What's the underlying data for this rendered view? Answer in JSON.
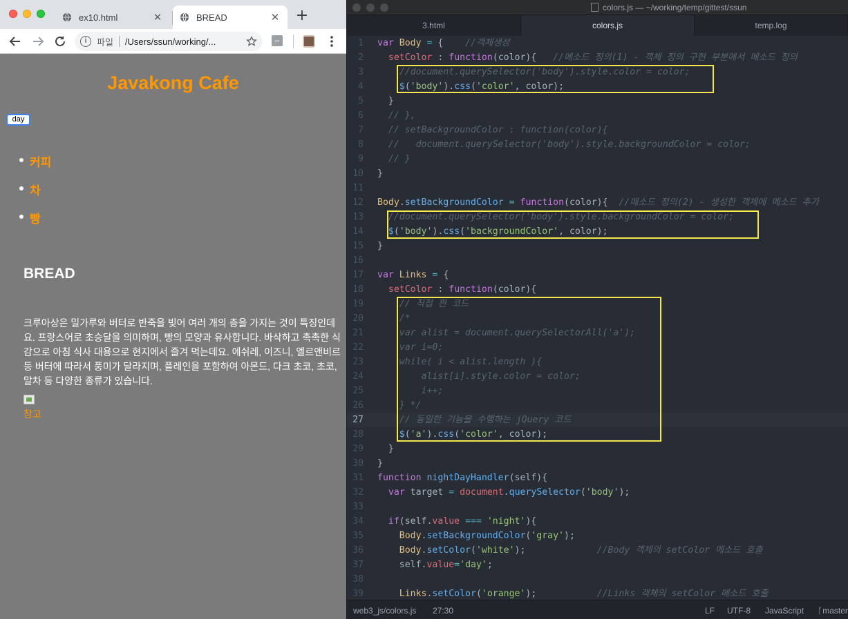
{
  "browser": {
    "tabs": [
      {
        "label": "ex10.html",
        "active": false
      },
      {
        "label": "BREAD",
        "active": true
      }
    ],
    "address": {
      "scheme_label": "파일",
      "url": "/Users/ssun/working/..."
    }
  },
  "page": {
    "cafe_title": "Javakong Cafe",
    "toggle_button": "day",
    "menu_items": [
      "커피",
      "차",
      "빵"
    ],
    "heading": "BREAD",
    "description": "크루아상은 밀가루와 버터로 반죽을 빚어 여러 개의 층을 가지는 것이 특징인데요. 프랑스어로 초승달을 의미하며, 빵의 모양과 유사합니다. 바삭하고 촉촉한 식감으로 아침 식사 대용으로 현지에서 즐겨 먹는데요. 에쉬레, 이즈니, 엘르앤비르 등 버터에 따라서 풍미가 달라지며, 플레인을 포함하여 아몬드, 다크 초코, 초코, 말차 등 다양한 종류가 있습니다.",
    "link": "참고",
    "colors": {
      "link": "#ff9700",
      "background": "#7b7b7b",
      "text": "#ffffff"
    }
  },
  "editor": {
    "window_title": "colors.js — ~/working/temp/gittest/ssun",
    "tabs": [
      {
        "label": "3.html",
        "active": false
      },
      {
        "label": "colors.js",
        "active": true
      },
      {
        "label": "temp.log",
        "active": false
      }
    ],
    "current_line": 27,
    "lines": [
      [
        [
          "kw",
          "var "
        ],
        [
          "obj",
          "Body"
        ],
        [
          "pl",
          " "
        ],
        [
          "op",
          "="
        ],
        [
          "pl",
          " {    "
        ],
        [
          "cm",
          "//객체생성"
        ]
      ],
      [
        [
          "pl",
          "  "
        ],
        [
          "prop",
          "setColor"
        ],
        [
          "pl",
          " : "
        ],
        [
          "kw",
          "function"
        ],
        [
          "pl",
          "(color){   "
        ],
        [
          "cm",
          "//메소드 정의(1) - 객체 정의 구현 부분에서 메소드 정의"
        ]
      ],
      [
        [
          "cm",
          "    //document.querySelector('body').style.color = color;"
        ]
      ],
      [
        [
          "pl",
          "    "
        ],
        [
          "fn",
          "$"
        ],
        [
          "pl",
          "("
        ],
        [
          "str",
          "'body'"
        ],
        [
          "pl",
          ")."
        ],
        [
          "fn",
          "css"
        ],
        [
          "pl",
          "("
        ],
        [
          "str",
          "'color'"
        ],
        [
          "pl",
          ", color);"
        ]
      ],
      [
        [
          "pl",
          "  }"
        ]
      ],
      [
        [
          "cm",
          "  // },"
        ]
      ],
      [
        [
          "cm",
          "  // setBackgroundColor : function(color){"
        ]
      ],
      [
        [
          "cm",
          "  //   document.querySelector('body').style.backgroundColor = color;"
        ]
      ],
      [
        [
          "cm",
          "  // }"
        ]
      ],
      [
        [
          "pl",
          "}"
        ]
      ],
      [],
      [
        [
          "obj",
          "Body"
        ],
        [
          "pl",
          "."
        ],
        [
          "fn",
          "setBackgroundColor"
        ],
        [
          "pl",
          " "
        ],
        [
          "op",
          "="
        ],
        [
          "pl",
          " "
        ],
        [
          "kw",
          "function"
        ],
        [
          "pl",
          "(color){  "
        ],
        [
          "cm",
          "//메소드 정의(2) - 생성한 객체에 메소드 추가"
        ]
      ],
      [
        [
          "cm",
          "  //document.querySelector('body').style.backgroundColor = color;"
        ]
      ],
      [
        [
          "pl",
          "  "
        ],
        [
          "fn",
          "$"
        ],
        [
          "pl",
          "("
        ],
        [
          "str",
          "'body'"
        ],
        [
          "pl",
          ")."
        ],
        [
          "fn",
          "css"
        ],
        [
          "pl",
          "("
        ],
        [
          "str",
          "'backgroundColor'"
        ],
        [
          "pl",
          ", color);"
        ]
      ],
      [
        [
          "pl",
          "}"
        ]
      ],
      [],
      [
        [
          "kw",
          "var "
        ],
        [
          "obj",
          "Links"
        ],
        [
          "pl",
          " "
        ],
        [
          "op",
          "="
        ],
        [
          "pl",
          " {"
        ]
      ],
      [
        [
          "pl",
          "  "
        ],
        [
          "prop",
          "setColor"
        ],
        [
          "pl",
          " : "
        ],
        [
          "kw",
          "function"
        ],
        [
          "pl",
          "(color){"
        ]
      ],
      [
        [
          "cm",
          "    // 직접 짠 코드"
        ]
      ],
      [
        [
          "cm",
          "    /*"
        ]
      ],
      [
        [
          "cm",
          "    var alist = document.querySelectorAll('a');"
        ]
      ],
      [
        [
          "cm",
          "    var i=0;"
        ]
      ],
      [
        [
          "cm",
          "    while( i < alist.length ){"
        ]
      ],
      [
        [
          "cm",
          "        alist[i].style.color = color;"
        ]
      ],
      [
        [
          "cm",
          "        i++;"
        ]
      ],
      [
        [
          "cm",
          "    } */"
        ]
      ],
      [
        [
          "cm",
          "    // 동일한 기능을 수행하는 jQuery 코드"
        ]
      ],
      [
        [
          "pl",
          "    "
        ],
        [
          "fn",
          "$"
        ],
        [
          "pl",
          "("
        ],
        [
          "str",
          "'a'"
        ],
        [
          "pl",
          ")."
        ],
        [
          "fn",
          "css"
        ],
        [
          "pl",
          "("
        ],
        [
          "str",
          "'color'"
        ],
        [
          "pl",
          ", color);"
        ]
      ],
      [
        [
          "pl",
          "  }"
        ]
      ],
      [
        [
          "pl",
          "}"
        ]
      ],
      [
        [
          "kw",
          "function "
        ],
        [
          "fn",
          "nightDayHandler"
        ],
        [
          "pl",
          "(self){"
        ]
      ],
      [
        [
          "pl",
          "  "
        ],
        [
          "kw",
          "var "
        ],
        [
          "pl",
          "target "
        ],
        [
          "op",
          "="
        ],
        [
          "pl",
          " "
        ],
        [
          "prop",
          "document"
        ],
        [
          "pl",
          "."
        ],
        [
          "fn",
          "querySelector"
        ],
        [
          "pl",
          "("
        ],
        [
          "str",
          "'body'"
        ],
        [
          "pl",
          ");"
        ]
      ],
      [],
      [
        [
          "pl",
          "  "
        ],
        [
          "kw",
          "if"
        ],
        [
          "pl",
          "(self."
        ],
        [
          "prop",
          "value"
        ],
        [
          "pl",
          " "
        ],
        [
          "op",
          "==="
        ],
        [
          "pl",
          " "
        ],
        [
          "str",
          "'night'"
        ],
        [
          "pl",
          "){"
        ]
      ],
      [
        [
          "pl",
          "    "
        ],
        [
          "obj",
          "Body"
        ],
        [
          "pl",
          "."
        ],
        [
          "fn",
          "setBackgroundColor"
        ],
        [
          "pl",
          "("
        ],
        [
          "str",
          "'gray'"
        ],
        [
          "pl",
          ");"
        ]
      ],
      [
        [
          "pl",
          "    "
        ],
        [
          "obj",
          "Body"
        ],
        [
          "pl",
          "."
        ],
        [
          "fn",
          "setColor"
        ],
        [
          "pl",
          "("
        ],
        [
          "str",
          "'white'"
        ],
        [
          "pl",
          ");             "
        ],
        [
          "cm",
          "//Body 객체의 setColor 메소드 호출"
        ]
      ],
      [
        [
          "pl",
          "    self."
        ],
        [
          "prop",
          "value"
        ],
        [
          "op",
          "="
        ],
        [
          "str",
          "'day'"
        ],
        [
          "pl",
          ";"
        ]
      ],
      [],
      [
        [
          "pl",
          "    "
        ],
        [
          "obj",
          "Links"
        ],
        [
          "pl",
          "."
        ],
        [
          "fn",
          "setColor"
        ],
        [
          "pl",
          "("
        ],
        [
          "str",
          "'orange'"
        ],
        [
          "pl",
          ");           "
        ],
        [
          "cm",
          "//Links 객체의 setColor 메소드 호출"
        ]
      ]
    ],
    "status": {
      "path": "web3_js/colors.js",
      "cursor": "27:30",
      "line_ending": "LF",
      "encoding": "UTF-8",
      "grammar": "JavaScript",
      "branch": "master"
    },
    "colors": {
      "highlight_box": "#f5e84a",
      "background": "#282c34"
    }
  }
}
